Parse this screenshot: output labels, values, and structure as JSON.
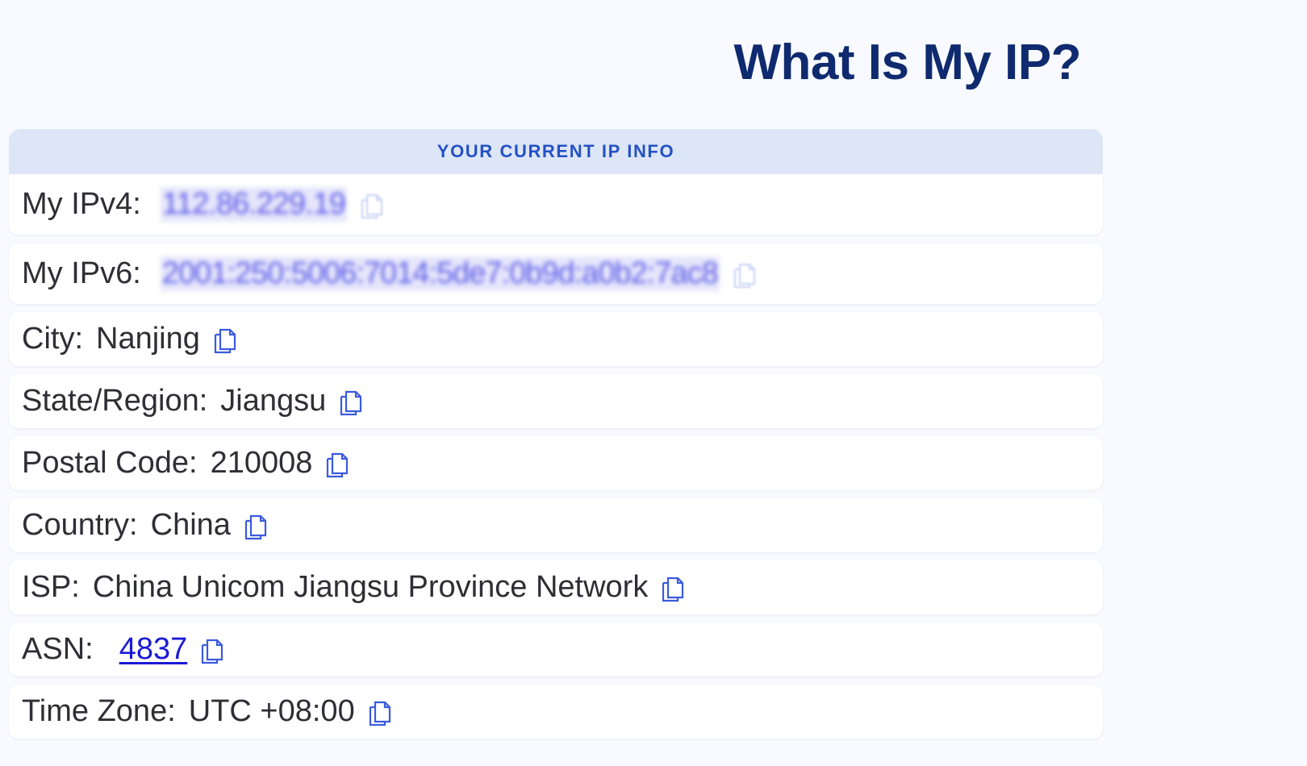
{
  "page": {
    "title": "What Is My IP?"
  },
  "panel": {
    "header": "YOUR CURRENT IP INFO"
  },
  "rows": {
    "ipv4": {
      "label": "My IPv4:",
      "value": "112.86.229.19"
    },
    "ipv6": {
      "label": "My IPv6:",
      "value": "2001:250:5006:7014:5de7:0b9d:a0b2:7ac8"
    },
    "city": {
      "label": "City:",
      "value": "Nanjing"
    },
    "state": {
      "label": "State/Region:",
      "value": "Jiangsu"
    },
    "postal": {
      "label": "Postal Code:",
      "value": "210008"
    },
    "country": {
      "label": "Country:",
      "value": "China"
    },
    "isp": {
      "label": "ISP:",
      "value": "China Unicom Jiangsu Province Network"
    },
    "asn": {
      "label": "ASN:",
      "value": "4837"
    },
    "timezone": {
      "label": "Time Zone:",
      "value": "UTC +08:00"
    }
  },
  "icons": {
    "copy": "copy-icon"
  },
  "colors": {
    "title": "#0f2a6e",
    "header_bg": "#dde6f7",
    "header_text": "#2451c4",
    "link": "#1a1ad6",
    "icon": "#3b5bdb"
  }
}
